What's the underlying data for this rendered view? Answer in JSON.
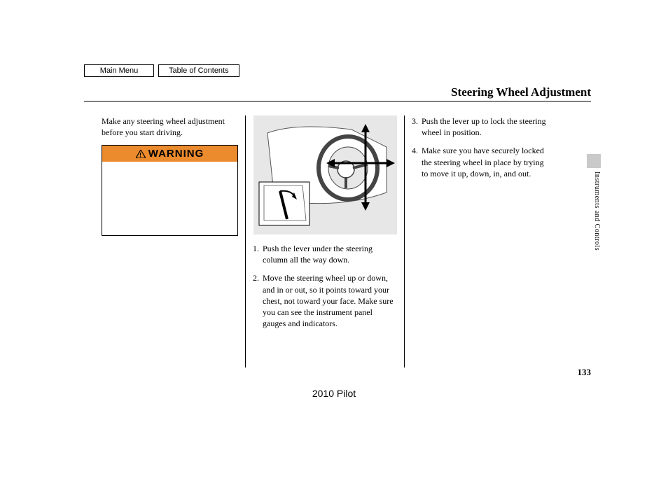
{
  "nav": {
    "main_menu": "Main Menu",
    "toc": "Table of Contents"
  },
  "title": "Steering Wheel Adjustment",
  "col1": {
    "intro": "Make any steering wheel adjustment before you start driving.",
    "warning_label": "WARNING"
  },
  "col2": {
    "step1_num": "1.",
    "step1": "Push the lever under the steering column all the way down.",
    "step2_num": "2.",
    "step2": "Move the steering wheel up or down, and in or out, so it points toward your chest, not toward your face. Make sure you can see the instrument panel gauges and indicators."
  },
  "col3": {
    "step3_num": "3.",
    "step3": "Push the lever up to lock the steering wheel in position.",
    "step4_num": "4.",
    "step4": "Make sure you have securely locked the steering wheel in place by trying to move it up, down, in, and out."
  },
  "side_section": "Instruments and Controls",
  "page_number": "133",
  "footer_model": "2010 Pilot"
}
